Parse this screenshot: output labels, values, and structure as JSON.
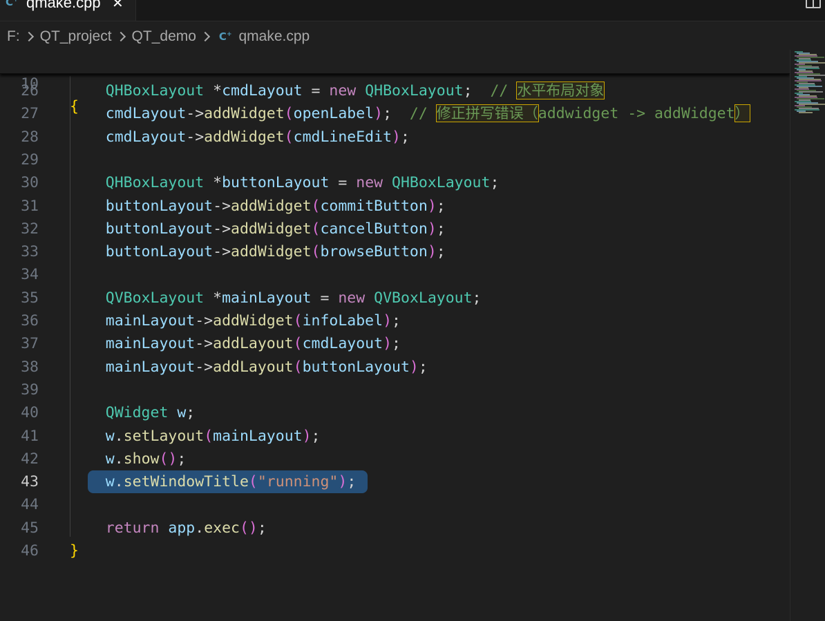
{
  "tab": {
    "icon": "cpp-file-icon",
    "title": "qmake.cpp",
    "close": "✕"
  },
  "breadcrumb": [
    "F:",
    "QT_project",
    "QT_demo",
    "qmake.cpp"
  ],
  "editor": {
    "active_line": 43,
    "sticky": {
      "num": "10",
      "text": "{"
    },
    "lines": [
      {
        "num": "26",
        "tokens": [
          {
            "t": "    "
          },
          {
            "t": "QHBoxLayout",
            "c": "t"
          },
          {
            "t": " *",
            "c": "w"
          },
          {
            "t": "cmdLayout",
            "c": "v"
          },
          {
            "t": " = ",
            "c": "w"
          },
          {
            "t": "new",
            "c": "k"
          },
          {
            "t": " ",
            "c": "w"
          },
          {
            "t": "QHBoxLayout",
            "c": "t"
          },
          {
            "t": ";  ",
            "c": "w"
          },
          {
            "t": "// ",
            "c": "c"
          },
          {
            "t": "水平布局对象",
            "c": "c hl"
          }
        ]
      },
      {
        "num": "27",
        "tokens": [
          {
            "t": "    "
          },
          {
            "t": "cmdLayout",
            "c": "v"
          },
          {
            "t": "->",
            "c": "w"
          },
          {
            "t": "addWidget",
            "c": "f"
          },
          {
            "t": "(",
            "c": "p"
          },
          {
            "t": "openLabel",
            "c": "v"
          },
          {
            "t": ")",
            "c": "p"
          },
          {
            "t": ";  ",
            "c": "w"
          },
          {
            "t": "// ",
            "c": "c"
          },
          {
            "t": "修正拼写错误（",
            "c": "c hl"
          },
          {
            "t": "addwidget -> addWidget",
            "c": "c"
          },
          {
            "t": "）",
            "c": "c hl"
          }
        ]
      },
      {
        "num": "28",
        "tokens": [
          {
            "t": "    "
          },
          {
            "t": "cmdLayout",
            "c": "v"
          },
          {
            "t": "->",
            "c": "w"
          },
          {
            "t": "addWidget",
            "c": "f"
          },
          {
            "t": "(",
            "c": "p"
          },
          {
            "t": "cmdLineEdit",
            "c": "v"
          },
          {
            "t": ")",
            "c": "p"
          },
          {
            "t": ";",
            "c": "w"
          }
        ]
      },
      {
        "num": "29",
        "tokens": []
      },
      {
        "num": "30",
        "tokens": [
          {
            "t": "    "
          },
          {
            "t": "QHBoxLayout",
            "c": "t"
          },
          {
            "t": " *",
            "c": "w"
          },
          {
            "t": "buttonLayout",
            "c": "v"
          },
          {
            "t": " = ",
            "c": "w"
          },
          {
            "t": "new",
            "c": "k"
          },
          {
            "t": " ",
            "c": "w"
          },
          {
            "t": "QHBoxLayout",
            "c": "t"
          },
          {
            "t": ";",
            "c": "w"
          }
        ]
      },
      {
        "num": "31",
        "tokens": [
          {
            "t": "    "
          },
          {
            "t": "buttonLayout",
            "c": "v"
          },
          {
            "t": "->",
            "c": "w"
          },
          {
            "t": "addWidget",
            "c": "f"
          },
          {
            "t": "(",
            "c": "p"
          },
          {
            "t": "commitButton",
            "c": "v"
          },
          {
            "t": ")",
            "c": "p"
          },
          {
            "t": ";",
            "c": "w"
          }
        ]
      },
      {
        "num": "32",
        "tokens": [
          {
            "t": "    "
          },
          {
            "t": "buttonLayout",
            "c": "v"
          },
          {
            "t": "->",
            "c": "w"
          },
          {
            "t": "addWidget",
            "c": "f"
          },
          {
            "t": "(",
            "c": "p"
          },
          {
            "t": "cancelButton",
            "c": "v"
          },
          {
            "t": ")",
            "c": "p"
          },
          {
            "t": ";",
            "c": "w"
          }
        ]
      },
      {
        "num": "33",
        "tokens": [
          {
            "t": "    "
          },
          {
            "t": "buttonLayout",
            "c": "v"
          },
          {
            "t": "->",
            "c": "w"
          },
          {
            "t": "addWidget",
            "c": "f"
          },
          {
            "t": "(",
            "c": "p"
          },
          {
            "t": "browseButton",
            "c": "v"
          },
          {
            "t": ")",
            "c": "p"
          },
          {
            "t": ";",
            "c": "w"
          }
        ]
      },
      {
        "num": "34",
        "tokens": []
      },
      {
        "num": "35",
        "tokens": [
          {
            "t": "    "
          },
          {
            "t": "QVBoxLayout",
            "c": "t"
          },
          {
            "t": " *",
            "c": "w"
          },
          {
            "t": "mainLayout",
            "c": "v"
          },
          {
            "t": " = ",
            "c": "w"
          },
          {
            "t": "new",
            "c": "k"
          },
          {
            "t": " ",
            "c": "w"
          },
          {
            "t": "QVBoxLayout",
            "c": "t"
          },
          {
            "t": ";",
            "c": "w"
          }
        ]
      },
      {
        "num": "36",
        "tokens": [
          {
            "t": "    "
          },
          {
            "t": "mainLayout",
            "c": "v"
          },
          {
            "t": "->",
            "c": "w"
          },
          {
            "t": "addWidget",
            "c": "f"
          },
          {
            "t": "(",
            "c": "p"
          },
          {
            "t": "infoLabel",
            "c": "v"
          },
          {
            "t": ")",
            "c": "p"
          },
          {
            "t": ";",
            "c": "w"
          }
        ]
      },
      {
        "num": "37",
        "tokens": [
          {
            "t": "    "
          },
          {
            "t": "mainLayout",
            "c": "v"
          },
          {
            "t": "->",
            "c": "w"
          },
          {
            "t": "addLayout",
            "c": "f"
          },
          {
            "t": "(",
            "c": "p"
          },
          {
            "t": "cmdLayout",
            "c": "v"
          },
          {
            "t": ")",
            "c": "p"
          },
          {
            "t": ";",
            "c": "w"
          }
        ]
      },
      {
        "num": "38",
        "tokens": [
          {
            "t": "    "
          },
          {
            "t": "mainLayout",
            "c": "v"
          },
          {
            "t": "->",
            "c": "w"
          },
          {
            "t": "addLayout",
            "c": "f"
          },
          {
            "t": "(",
            "c": "p"
          },
          {
            "t": "buttonLayout",
            "c": "v"
          },
          {
            "t": ")",
            "c": "p"
          },
          {
            "t": ";",
            "c": "w"
          }
        ]
      },
      {
        "num": "39",
        "tokens": []
      },
      {
        "num": "40",
        "tokens": [
          {
            "t": "    "
          },
          {
            "t": "QWidget",
            "c": "t"
          },
          {
            "t": " ",
            "c": "w"
          },
          {
            "t": "w",
            "c": "v"
          },
          {
            "t": ";",
            "c": "w"
          }
        ]
      },
      {
        "num": "41",
        "tokens": [
          {
            "t": "    "
          },
          {
            "t": "w",
            "c": "v"
          },
          {
            "t": ".",
            "c": "w"
          },
          {
            "t": "setLayout",
            "c": "f"
          },
          {
            "t": "(",
            "c": "p"
          },
          {
            "t": "mainLayout",
            "c": "v"
          },
          {
            "t": ")",
            "c": "p"
          },
          {
            "t": ";",
            "c": "w"
          }
        ]
      },
      {
        "num": "42",
        "tokens": [
          {
            "t": "    "
          },
          {
            "t": "w",
            "c": "v"
          },
          {
            "t": ".",
            "c": "w"
          },
          {
            "t": "show",
            "c": "f"
          },
          {
            "t": "()",
            "c": "p"
          },
          {
            "t": ";",
            "c": "w"
          }
        ]
      },
      {
        "num": "43",
        "tokens": [
          {
            "t": "    "
          },
          {
            "t": "w",
            "c": "v"
          },
          {
            "t": ".",
            "c": "w"
          },
          {
            "t": "setWindowTitle",
            "c": "f"
          },
          {
            "t": "(",
            "c": "p"
          },
          {
            "t": "\"running\"",
            "c": "s"
          },
          {
            "t": ")",
            "c": "p"
          },
          {
            "t": ";",
            "c": "w"
          }
        ]
      },
      {
        "num": "44",
        "tokens": []
      },
      {
        "num": "45",
        "tokens": [
          {
            "t": "    "
          },
          {
            "t": "return",
            "c": "k"
          },
          {
            "t": " ",
            "c": "w"
          },
          {
            "t": "app",
            "c": "v"
          },
          {
            "t": ".",
            "c": "w"
          },
          {
            "t": "exec",
            "c": "f"
          },
          {
            "t": "()",
            "c": "p"
          },
          {
            "t": ";",
            "c": "w"
          }
        ]
      },
      {
        "num": "46",
        "tokens": [
          {
            "t": "}",
            "c": "b"
          }
        ]
      }
    ]
  },
  "colors": {
    "background": "#1f1f1f",
    "type": "#4ec9b0",
    "variable": "#9cdcfe",
    "function": "#dcdcaa",
    "keyword": "#c586c0",
    "string": "#ce9178",
    "comment": "#6a9955",
    "selection": "#264f78"
  }
}
